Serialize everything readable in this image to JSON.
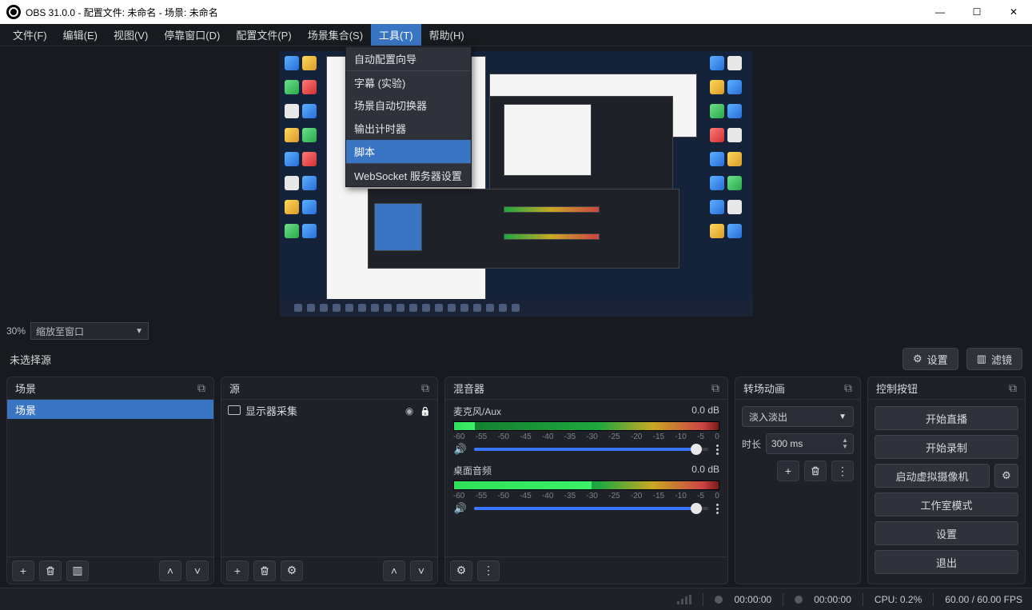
{
  "titlebar": {
    "title": "OBS 31.0.0 - 配置文件: 未命名 - 场景: 未命名"
  },
  "menu": {
    "file": "文件(F)",
    "edit": "编辑(E)",
    "view": "视图(V)",
    "dock": "停靠窗口(D)",
    "profile": "配置文件(P)",
    "scene_collection": "场景集合(S)",
    "tools": "工具(T)",
    "help": "帮助(H)"
  },
  "tools_menu": {
    "auto_config": "自动配置向导",
    "captions": "字幕 (实验)",
    "scene_switcher": "场景自动切换器",
    "output_timer": "输出计时器",
    "scripts": "脚本",
    "websocket": "WebSocket 服务器设置"
  },
  "zoom": {
    "percent": "30%",
    "mode": "缩放至窗口"
  },
  "toolbar": {
    "no_source": "未选择源",
    "settings": "设置",
    "filters": "滤镜"
  },
  "docks": {
    "scenes": "场景",
    "sources": "源",
    "mixer": "混音器",
    "transitions": "转场动画",
    "controls": "控制按钮"
  },
  "scenes": {
    "item1": "场景"
  },
  "sources": {
    "item1": "显示器采集"
  },
  "mixer": {
    "mic_label": "麦克风/Aux",
    "mic_db": "0.0 dB",
    "desk_label": "桌面音频",
    "desk_db": "0.0 dB",
    "ticks": [
      "-60",
      "-55",
      "-50",
      "-45",
      "-40",
      "-35",
      "-30",
      "-25",
      "-20",
      "-15",
      "-10",
      "-5",
      "0"
    ]
  },
  "trans": {
    "type": "淡入淡出",
    "dur_label": "时长",
    "dur_value": "300 ms"
  },
  "controls": {
    "stream": "开始直播",
    "record": "开始录制",
    "vcam": "启动虚拟摄像机",
    "studio": "工作室模式",
    "settings": "设置",
    "exit": "退出"
  },
  "status": {
    "live": "00:00:00",
    "rec": "00:00:00",
    "cpu": "CPU: 0.2%",
    "fps": "60.00 / 60.00 FPS"
  }
}
